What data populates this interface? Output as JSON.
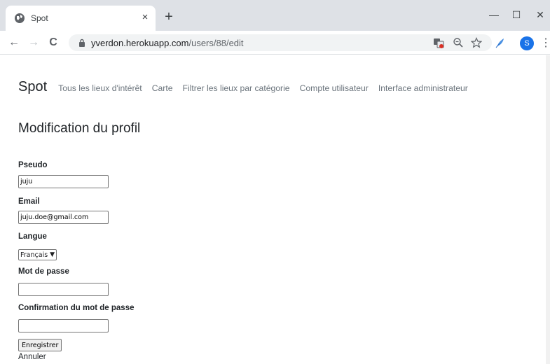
{
  "browser": {
    "tab_title": "Spot",
    "tab_close": "×",
    "new_tab": "+",
    "url_host": "yverdon.herokuapp.com",
    "url_path": "/users/88/edit",
    "profile_initial": "S",
    "window_minimize": "—",
    "window_maximize": "☐",
    "window_close": "✕",
    "back": "←",
    "forward": "→",
    "reload": "C",
    "menu": "⋮"
  },
  "nav": {
    "brand": "Spot",
    "links": [
      "Tous les lieux d'intérêt",
      "Carte",
      "Filtrer les lieux par catégorie",
      "Compte utilisateur",
      "Interface administrateur"
    ]
  },
  "form": {
    "title": "Modification du profil",
    "pseudo_label": "Pseudo",
    "pseudo_value": "juju",
    "email_label": "Email",
    "email_value": "juju.doe@gmail.com",
    "langue_label": "Langue",
    "langue_value": "Français",
    "password_label": "Mot de passe",
    "password_value": "",
    "confirm_label": "Confirmation du mot de passe",
    "confirm_value": "",
    "submit_label": "Enregistrer",
    "cancel_label": "Annuler"
  },
  "icons": {
    "tab_favicon": "globe-icon",
    "lock": "lock-icon",
    "translate": "translate-icon",
    "zoom": "zoom-icon",
    "bookmark": "star-icon",
    "extension": "feather-extension-icon"
  },
  "colors": {
    "profile": "#1a73e8",
    "nav_link": "#6c757d",
    "tabbar": "#dee1e6"
  }
}
